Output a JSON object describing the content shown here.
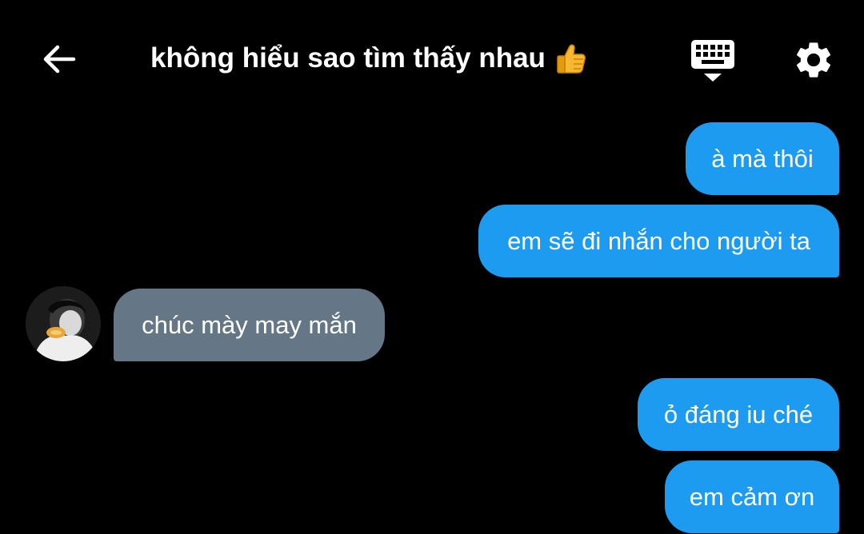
{
  "header": {
    "title": "không hiểu sao tìm thấy nhau",
    "title_emoji": "thumbs-up-emoji",
    "back_icon": "arrow-left-icon",
    "keyboard_icon": "keyboard-icon",
    "settings_icon": "gear-icon"
  },
  "messages": [
    {
      "direction": "sent",
      "text": "à mà thôi"
    },
    {
      "direction": "sent",
      "text": "em sẽ đi nhắn cho người ta"
    },
    {
      "direction": "received",
      "text": "chúc mày may mắn"
    },
    {
      "direction": "sent",
      "text": "ỏ đáng iu ché"
    },
    {
      "direction": "sent",
      "text": "em cảm ơn"
    }
  ],
  "colors": {
    "background": "#000000",
    "sent_bubble": "#1d9bf0",
    "received_bubble": "#657786",
    "text": "#ffffff"
  }
}
